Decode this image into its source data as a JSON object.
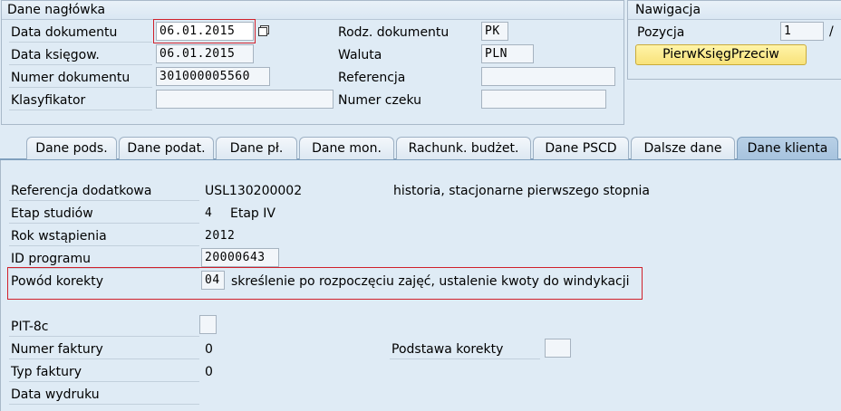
{
  "header_group": {
    "title": "Dane nagłówka",
    "fields": {
      "data_dokumentu": {
        "label": "Data dokumentu",
        "value": "06.01.2015"
      },
      "data_ksiegow": {
        "label": "Data księgow.",
        "value": "06.01.2015"
      },
      "numer_dokumentu": {
        "label": "Numer dokumentu",
        "value": "301000005560"
      },
      "klasyfikator": {
        "label": "Klasyfikator",
        "value": ""
      },
      "rodz_dokumentu": {
        "label": "Rodz. dokumentu",
        "value": "PK"
      },
      "waluta": {
        "label": "Waluta",
        "value": "PLN"
      },
      "referencja": {
        "label": "Referencja",
        "value": ""
      },
      "numer_czeku": {
        "label": "Numer czeku",
        "value": ""
      }
    }
  },
  "nav_group": {
    "title": "Nawigacja",
    "pozycja_label": "Pozycja",
    "pozycja_value": "1",
    "separator": "/",
    "button_label": "PierwKsięgPrzeciw"
  },
  "tabs": [
    {
      "label": "Dane pods.",
      "active": false
    },
    {
      "label": "Dane podat.",
      "active": false
    },
    {
      "label": "Dane pł.",
      "active": false
    },
    {
      "label": "Dane mon.",
      "active": false
    },
    {
      "label": "Rachunk. budżet.",
      "active": false
    },
    {
      "label": "Dane PSCD",
      "active": false
    },
    {
      "label": "Dalsze dane",
      "active": false
    },
    {
      "label": "Dane klienta",
      "active": true
    }
  ],
  "client": {
    "referencja_dodatkowa": {
      "label": "Referencja dodatkowa",
      "value": "USL130200002",
      "description": "historia, stacjonarne pierwszego stopnia"
    },
    "etap_studiow": {
      "label": "Etap studiów",
      "value": "4",
      "description": "Etap IV"
    },
    "rok_wstapienia": {
      "label": "Rok wstąpienia",
      "value": "2012"
    },
    "id_programu": {
      "label": "ID programu",
      "value": "20000643"
    },
    "powod_korekty": {
      "label": "Powód korekty",
      "value": "04",
      "description": "skreślenie po rozpoczęciu zajęć, ustalenie kwoty do windykacji"
    },
    "pit_8c": {
      "label": "PIT-8c",
      "checked": false
    },
    "numer_faktury": {
      "label": "Numer faktury",
      "value": "0"
    },
    "typ_faktury": {
      "label": "Typ faktury",
      "value": "0"
    },
    "data_wydruku": {
      "label": "Data wydruku",
      "value": ""
    },
    "podstawa_korekty": {
      "label": "Podstawa korekty",
      "checked": false
    }
  },
  "colors": {
    "background": "#dfebf5",
    "highlight_red": "#d0212b",
    "nav_button": "#f8e27a",
    "active_tab": "#a7c3de"
  }
}
